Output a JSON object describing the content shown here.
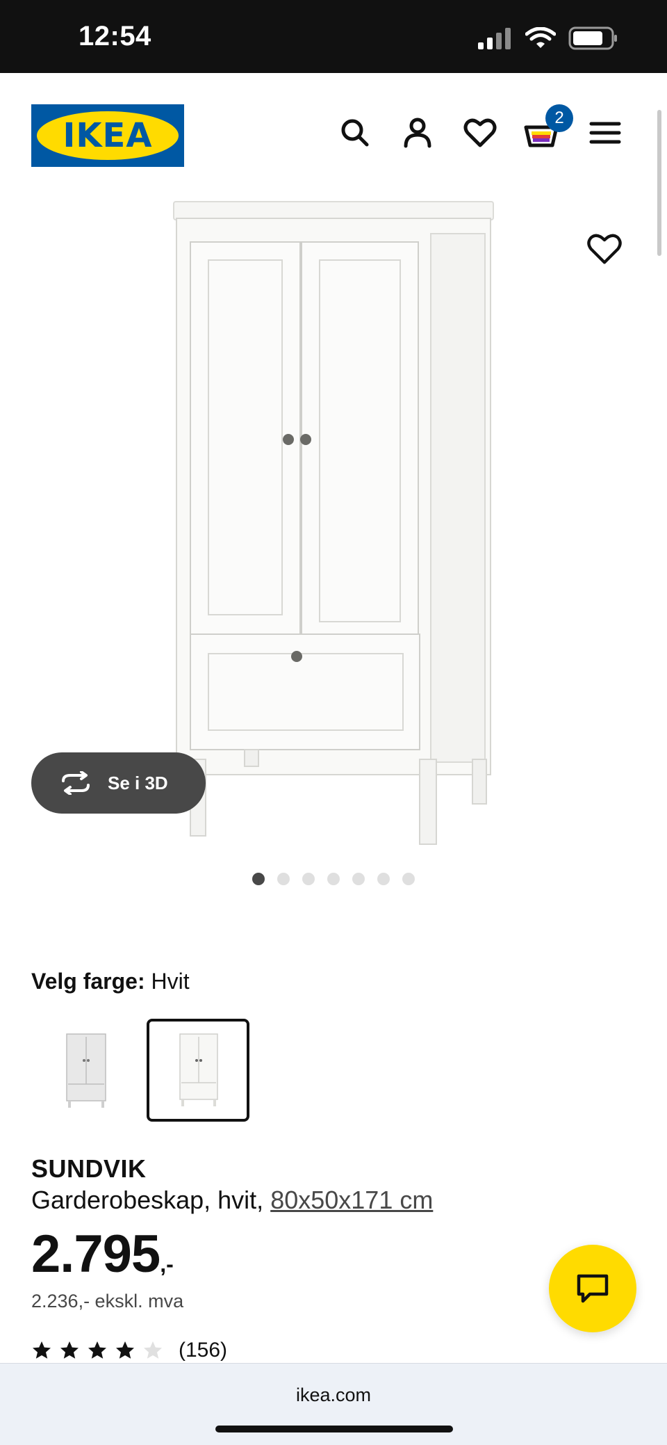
{
  "status_bar": {
    "time": "12:54"
  },
  "header": {
    "logo_text": "IKEA",
    "cart_count": "2",
    "icons": [
      "search-icon",
      "user-icon",
      "heart-icon",
      "cart-icon",
      "menu-icon"
    ]
  },
  "gallery": {
    "view_3d_label": "Se i 3D",
    "image_count": 7,
    "active_index": 0
  },
  "color_select": {
    "label": "Velg farge:",
    "value": "Hvit",
    "selected_swatch": 1
  },
  "product": {
    "name": "SUNDVIK",
    "description": "Garderobeskap, hvit, ",
    "dimensions": "80x50x171 cm",
    "price": "2.795",
    "price_suffix": ",-",
    "price_ex_vat": "2.236,- ekskl. mva",
    "rating": 4,
    "rating_max": 5,
    "review_count": "(156)"
  },
  "browser": {
    "url": "ikea.com"
  },
  "colors": {
    "brand_blue": "#0058a3",
    "brand_yellow": "#ffdb00",
    "dark_gray": "#484848"
  }
}
